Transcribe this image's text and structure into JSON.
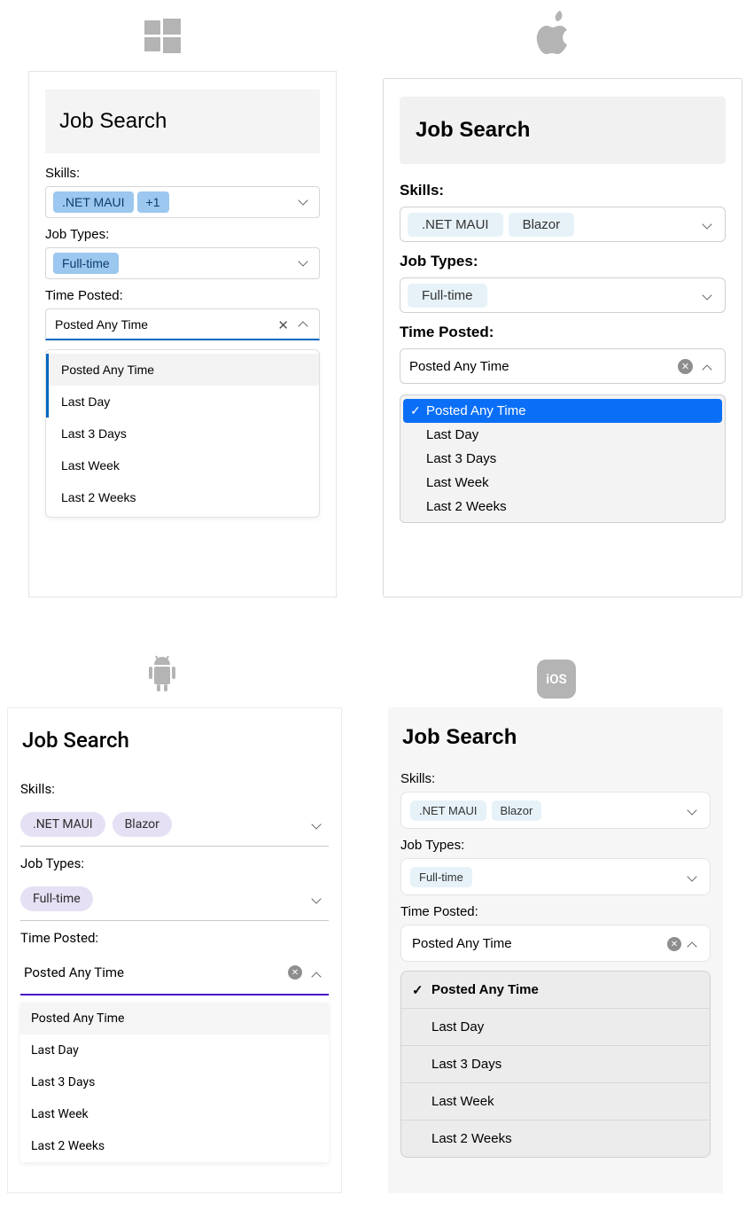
{
  "header_title": "Job Search",
  "labels": {
    "skills": "Skills:",
    "job_types": "Job Types:",
    "time_posted": "Time Posted:"
  },
  "time_options": [
    "Posted Any Time",
    "Last Day",
    "Last 3 Days",
    "Last Week",
    "Last 2 Weeks"
  ],
  "selected_time": "Posted Any Time",
  "windows": {
    "skills_chip": ".NET MAUI",
    "skills_more": "+1",
    "jobtype_chip": "Full-time"
  },
  "mac": {
    "skills_chip1": ".NET MAUI",
    "skills_chip2": "Blazor",
    "jobtype_chip": "Full-time"
  },
  "android": {
    "skills_chip1": ".NET MAUI",
    "skills_chip2": "Blazor",
    "jobtype_chip": "Full-time"
  },
  "ios": {
    "skills_chip1": ".NET MAUI",
    "skills_chip2": "Blazor",
    "jobtype_chip": "Full-time"
  }
}
